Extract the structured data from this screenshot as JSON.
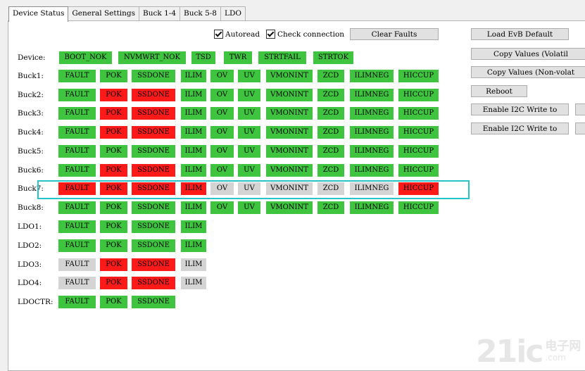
{
  "tabs": [
    "Device Status",
    "General Settings",
    "Buck 1-4",
    "Buck 5-8",
    "LDO"
  ],
  "autoread_label": "Autoread",
  "check_connection_label": "Check connection",
  "clear_faults_label": "Clear Faults",
  "right_buttons": [
    "Load EvB Default",
    "Copy Values (Volatil",
    "Copy Values (Non-volat",
    "Reboot",
    "Enable I2C Write to",
    "Enable I2C Write to"
  ],
  "rows": [
    {
      "label": "Device:",
      "cells": [
        [
          "BOOT_NOK",
          "on"
        ],
        [
          "NVMWRT_NOK",
          "on"
        ],
        [
          "TSD",
          "on"
        ],
        [
          "TWR",
          "on"
        ],
        [
          "STRTFAIL",
          "on"
        ],
        [
          "STRTOK",
          "on"
        ]
      ]
    },
    {
      "label": "Buck1:",
      "cells": [
        [
          "FAULT",
          "on"
        ],
        [
          "POK",
          "on"
        ],
        [
          "SSDONE",
          "on"
        ],
        [
          "ILIM",
          "on"
        ],
        [
          "OV",
          "on"
        ],
        [
          "UV",
          "on"
        ],
        [
          "VMONINT",
          "on"
        ],
        [
          "ZCD",
          "on"
        ],
        [
          "ILIMNEG",
          "on"
        ],
        [
          "HICCUP",
          "on"
        ]
      ]
    },
    {
      "label": "Buck2:",
      "cells": [
        [
          "FAULT",
          "on"
        ],
        [
          "POK",
          "bad"
        ],
        [
          "SSDONE",
          "bad"
        ],
        [
          "ILIM",
          "on"
        ],
        [
          "OV",
          "on"
        ],
        [
          "UV",
          "on"
        ],
        [
          "VMONINT",
          "on"
        ],
        [
          "ZCD",
          "on"
        ],
        [
          "ILIMNEG",
          "on"
        ],
        [
          "HICCUP",
          "on"
        ]
      ]
    },
    {
      "label": "Buck3:",
      "cells": [
        [
          "FAULT",
          "on"
        ],
        [
          "POK",
          "bad"
        ],
        [
          "SSDONE",
          "bad"
        ],
        [
          "ILIM",
          "on"
        ],
        [
          "OV",
          "on"
        ],
        [
          "UV",
          "on"
        ],
        [
          "VMONINT",
          "on"
        ],
        [
          "ZCD",
          "on"
        ],
        [
          "ILIMNEG",
          "on"
        ],
        [
          "HICCUP",
          "on"
        ]
      ]
    },
    {
      "label": "Buck4:",
      "cells": [
        [
          "FAULT",
          "on"
        ],
        [
          "POK",
          "bad"
        ],
        [
          "SSDONE",
          "bad"
        ],
        [
          "ILIM",
          "on"
        ],
        [
          "OV",
          "on"
        ],
        [
          "UV",
          "on"
        ],
        [
          "VMONINT",
          "on"
        ],
        [
          "ZCD",
          "on"
        ],
        [
          "ILIMNEG",
          "on"
        ],
        [
          "HICCUP",
          "on"
        ]
      ]
    },
    {
      "label": "Buck5:",
      "cells": [
        [
          "FAULT",
          "on"
        ],
        [
          "POK",
          "on"
        ],
        [
          "SSDONE",
          "on"
        ],
        [
          "ILIM",
          "on"
        ],
        [
          "OV",
          "on"
        ],
        [
          "UV",
          "on"
        ],
        [
          "VMONINT",
          "on"
        ],
        [
          "ZCD",
          "on"
        ],
        [
          "ILIMNEG",
          "on"
        ],
        [
          "HICCUP",
          "on"
        ]
      ]
    },
    {
      "label": "Buck6:",
      "cells": [
        [
          "FAULT",
          "on"
        ],
        [
          "POK",
          "bad"
        ],
        [
          "SSDONE",
          "bad"
        ],
        [
          "ILIM",
          "on"
        ],
        [
          "OV",
          "on"
        ],
        [
          "UV",
          "on"
        ],
        [
          "VMONINT",
          "on"
        ],
        [
          "ZCD",
          "on"
        ],
        [
          "ILIMNEG",
          "on"
        ],
        [
          "HICCUP",
          "on"
        ]
      ]
    },
    {
      "label": "Buck7:",
      "cells": [
        [
          "FAULT",
          "bad"
        ],
        [
          "POK",
          "bad"
        ],
        [
          "SSDONE",
          "bad"
        ],
        [
          "ILIM",
          "bad"
        ],
        [
          "OV",
          "off"
        ],
        [
          "UV",
          "off"
        ],
        [
          "VMONINT",
          "off"
        ],
        [
          "ZCD",
          "off"
        ],
        [
          "ILIMNEG",
          "off"
        ],
        [
          "HICCUP",
          "bad"
        ]
      ]
    },
    {
      "label": "Buck8:",
      "cells": [
        [
          "FAULT",
          "on"
        ],
        [
          "POK",
          "on"
        ],
        [
          "SSDONE",
          "on"
        ],
        [
          "ILIM",
          "on"
        ],
        [
          "OV",
          "on"
        ],
        [
          "UV",
          "on"
        ],
        [
          "VMONINT",
          "on"
        ],
        [
          "ZCD",
          "on"
        ],
        [
          "ILIMNEG",
          "on"
        ],
        [
          "HICCUP",
          "on"
        ]
      ]
    },
    {
      "label": "LDO1:",
      "cells": [
        [
          "FAULT",
          "on"
        ],
        [
          "POK",
          "on"
        ],
        [
          "SSDONE",
          "on"
        ],
        [
          "ILIM",
          "on"
        ]
      ]
    },
    {
      "label": "LDO2:",
      "cells": [
        [
          "FAULT",
          "on"
        ],
        [
          "POK",
          "on"
        ],
        [
          "SSDONE",
          "on"
        ],
        [
          "ILIM",
          "on"
        ]
      ]
    },
    {
      "label": "LDO3:",
      "cells": [
        [
          "FAULT",
          "off"
        ],
        [
          "POK",
          "bad"
        ],
        [
          "SSDONE",
          "bad"
        ],
        [
          "ILIM",
          "off"
        ]
      ]
    },
    {
      "label": "LDO4:",
      "cells": [
        [
          "FAULT",
          "off"
        ],
        [
          "POK",
          "bad"
        ],
        [
          "SSDONE",
          "bad"
        ],
        [
          "ILIM",
          "off"
        ]
      ]
    },
    {
      "label": "LDOCTR:",
      "cells": [
        [
          "FAULT",
          "on"
        ],
        [
          "POK",
          "on"
        ],
        [
          "SSDONE",
          "on"
        ]
      ]
    }
  ],
  "watermark": {
    "big": "21ic",
    "cn": "电子网",
    "com": ".com"
  }
}
